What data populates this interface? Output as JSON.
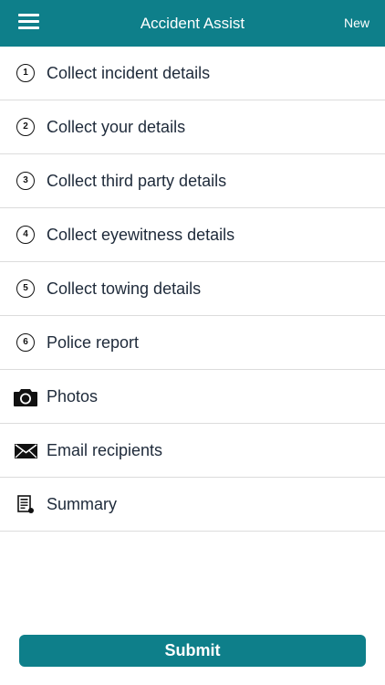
{
  "header": {
    "title": "Accident Assist",
    "new_label": "New",
    "background": "#0e7f8a"
  },
  "menu": {
    "items": [
      {
        "number": "1",
        "label": "Collect incident details",
        "icon": "number-1-icon"
      },
      {
        "number": "2",
        "label": "Collect your details",
        "icon": "number-2-icon"
      },
      {
        "number": "3",
        "label": "Collect third party details",
        "icon": "number-3-icon"
      },
      {
        "number": "4",
        "label": "Collect eyewitness details",
        "icon": "number-4-icon"
      },
      {
        "number": "5",
        "label": "Collect towing details",
        "icon": "number-5-icon"
      },
      {
        "number": "6",
        "label": "Police report",
        "icon": "number-6-icon"
      },
      {
        "label": "Photos",
        "icon": "camera-icon"
      },
      {
        "label": "Email recipients",
        "icon": "envelope-icon"
      },
      {
        "label": "Summary",
        "icon": "summary-document-icon"
      }
    ]
  },
  "footer": {
    "submit_label": "Submit"
  }
}
